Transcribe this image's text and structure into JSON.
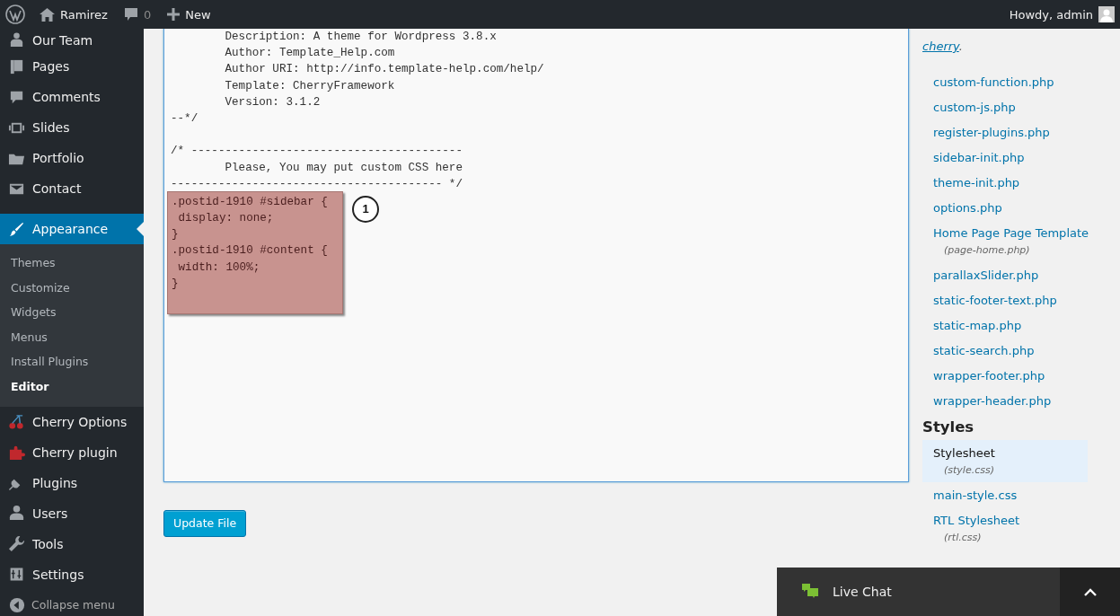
{
  "admin_bar": {
    "site": "Ramirez",
    "comments": "0",
    "new": "New",
    "greeting": "Howdy, admin"
  },
  "menu": {
    "items": [
      {
        "label": "Our Team",
        "selected": false
      },
      {
        "label": "Pages",
        "selected": false
      },
      {
        "label": "Comments",
        "selected": false
      },
      {
        "label": "Slides",
        "selected": false
      },
      {
        "label": "Portfolio",
        "selected": false
      },
      {
        "label": "Contact",
        "selected": false
      },
      {
        "label": "Appearance",
        "selected": true,
        "submenu": [
          {
            "label": "Themes",
            "selected": false
          },
          {
            "label": "Customize",
            "selected": false
          },
          {
            "label": "Widgets",
            "selected": false
          },
          {
            "label": "Menus",
            "selected": false
          },
          {
            "label": "Install Plugins",
            "selected": false
          },
          {
            "label": "Editor",
            "selected": true
          }
        ]
      },
      {
        "label": "Cherry Options",
        "selected": false
      },
      {
        "label": "Cherry plugin",
        "selected": false
      },
      {
        "label": "Plugins",
        "selected": false
      },
      {
        "label": "Users",
        "selected": false
      },
      {
        "label": "Tools",
        "selected": false
      },
      {
        "label": "Settings",
        "selected": false
      }
    ],
    "collapse": "Collapse menu"
  },
  "editor": {
    "lines": [
      "        Description: A theme for Wordpress 3.8.x",
      "        Author: Template_Help.com",
      "        Author URI: http://info.template-help.com/help/",
      "        Template: CherryFramework",
      "        Version: 3.1.2",
      "--*/"
    ],
    "lines_after_gap": [
      "/* ----------------------------------------",
      "        Please, You may put custom CSS here",
      "---------------------------------------- */"
    ],
    "highlighted_lines": [
      ".postid-1910 #sidebar {",
      " display: none;",
      "}",
      ".postid-1910 #content {",
      " width: 100%;",
      "}"
    ],
    "callout": "1"
  },
  "update_button": "Update File",
  "files": {
    "intro_link": "cherry",
    "intro_end": ".",
    "templates": [
      {
        "name": "custom-function.php",
        "selected": false
      },
      {
        "name": "custom-js.php",
        "selected": false
      },
      {
        "name": "register-plugins.php",
        "selected": false
      },
      {
        "name": "sidebar-init.php",
        "selected": false
      },
      {
        "name": "theme-init.php",
        "selected": false
      },
      {
        "name": "options.php",
        "selected": false
      },
      {
        "name": "Home Page Page Template",
        "file": "(page-home.php)",
        "selected": false
      },
      {
        "name": "parallaxSlider.php",
        "selected": false
      },
      {
        "name": "static-footer-text.php",
        "selected": false
      },
      {
        "name": "static-map.php",
        "selected": false
      },
      {
        "name": "static-search.php",
        "selected": false
      },
      {
        "name": "wrapper-footer.php",
        "selected": false
      },
      {
        "name": "wrapper-header.php",
        "selected": false
      }
    ],
    "styles_heading": "Styles",
    "styles": [
      {
        "name": "Stylesheet",
        "file": "(style.css)",
        "selected": true
      },
      {
        "name": "main-style.css",
        "selected": false
      },
      {
        "name": "RTL Stylesheet",
        "file": "(rtl.css)",
        "selected": false
      }
    ]
  },
  "live_chat": {
    "label": "Live Chat"
  }
}
